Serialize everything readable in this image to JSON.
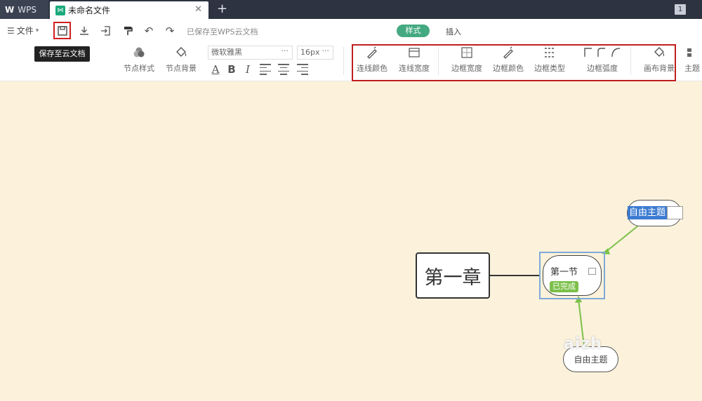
{
  "titlebar": {
    "app_tab": "WPS",
    "doc_tab": "未命名文件",
    "new_tab_icon": "plus",
    "page_count": "1"
  },
  "toolbar": {
    "file_menu": "文件",
    "save_tooltip": "保存至云文档",
    "saved_status": "已保存至WPS云文档",
    "mode_tabs": [
      "样式",
      "插入"
    ],
    "node_style": "节点样式",
    "node_background": "节点背景",
    "font_name": "微软雅黑",
    "font_size": "16px",
    "bold": "B",
    "italic": "I",
    "font_color": "A",
    "line_color": "连线颜色",
    "line_width": "连线宽度",
    "border_width": "边框宽度",
    "border_color": "边框颜色",
    "border_type": "边框类型",
    "border_radius": "边框弧度",
    "canvas_background": "画布背景",
    "theme": "主题"
  },
  "mindmap": {
    "root": "第一章",
    "section": "第一节",
    "section_badge": "已完成",
    "topic_top": "自由主题",
    "topic_bottom": "自由主题"
  },
  "watermark": "aizh",
  "colors": {
    "titlebar": "#2d3341",
    "accent": "#44a981",
    "highlight": "#c01e1e",
    "canvas": "#fcf2db",
    "link_green": "#7cc04a",
    "badge_green": "#7cc04a"
  }
}
